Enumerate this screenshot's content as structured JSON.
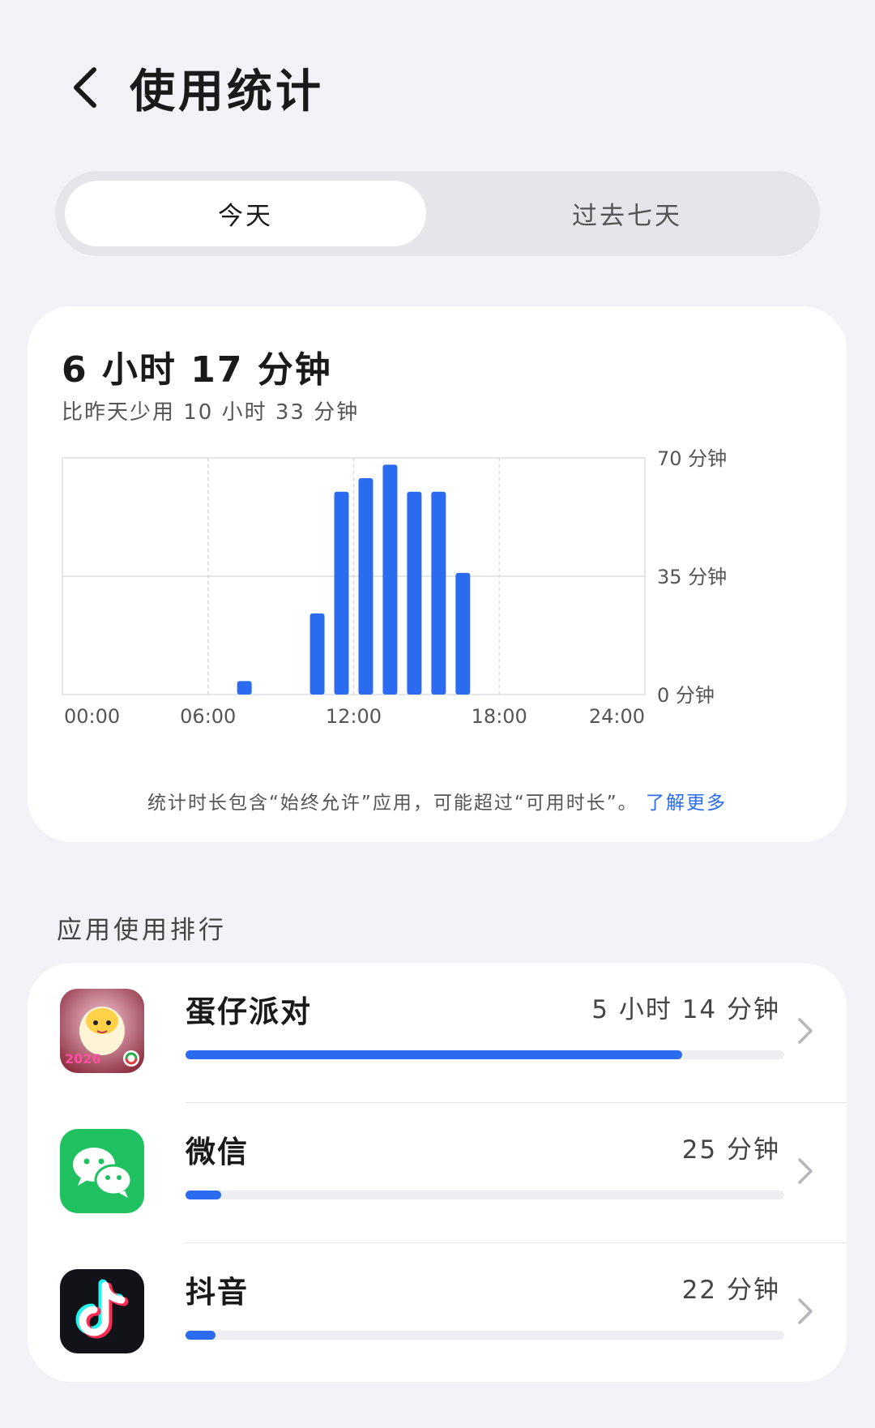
{
  "header": {
    "title": "使用统计",
    "back_icon": "chevron-left-icon"
  },
  "tabs": [
    {
      "label": "今天",
      "active": true
    },
    {
      "label": "过去七天",
      "active": false
    }
  ],
  "summary": {
    "total": "6 小时 17 分钟",
    "compare": "比昨天少用 10 小时 33 分钟",
    "note": "统计时长包含“始终允许”应用，可能超过“可用时长”。",
    "note_link": "了解更多"
  },
  "chart_data": {
    "type": "bar",
    "x_unit": "hour",
    "bins": [
      7,
      10,
      11,
      12,
      13,
      14,
      15,
      16
    ],
    "values": [
      4,
      24,
      60,
      64,
      68,
      60,
      60,
      36
    ],
    "ylim": [
      0,
      70
    ],
    "xlim": [
      0,
      24
    ],
    "y_ticks": [
      "70 分钟",
      "35 分钟",
      "0 分钟"
    ],
    "x_ticks": [
      "00:00",
      "06:00",
      "12:00",
      "18:00",
      "24:00"
    ],
    "grid": true,
    "bar_color": "#2a6bf0"
  },
  "ranking": {
    "title": "应用使用排行",
    "apps": [
      {
        "name": "蛋仔派对",
        "time": "5 小时 14 分钟",
        "progress": 0.83,
        "icon": "eggy-party-icon"
      },
      {
        "name": "微信",
        "time": "25 分钟",
        "progress": 0.06,
        "icon": "wechat-icon"
      },
      {
        "name": "抖音",
        "time": "22 分钟",
        "progress": 0.05,
        "icon": "douyin-icon"
      }
    ]
  },
  "colors": {
    "accent": "#2a6bf0",
    "background": "#f1f3f7"
  }
}
